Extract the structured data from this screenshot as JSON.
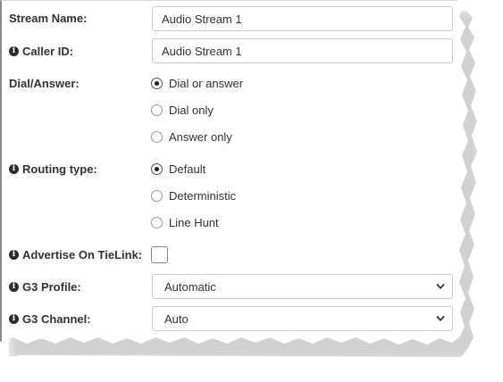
{
  "form": {
    "stream_name": {
      "label": "Stream Name:",
      "value": "Audio Stream 1"
    },
    "caller_id": {
      "label": "Caller ID:",
      "value": "Audio Stream 1",
      "icon": "info-icon"
    },
    "dial_answer": {
      "label": "Dial/Answer:",
      "options": [
        "Dial or answer",
        "Dial only",
        "Answer only"
      ],
      "selected": "Dial or answer"
    },
    "routing_type": {
      "label": "Routing type:",
      "icon": "info-icon",
      "options": [
        "Default",
        "Deterministic",
        "Line Hunt"
      ],
      "selected": "Default"
    },
    "advertise_tielink": {
      "label": "Advertise On TieLink:",
      "icon": "info-icon",
      "checked": false
    },
    "g3_profile": {
      "label": "G3 Profile:",
      "icon": "info-icon",
      "value": "Automatic"
    },
    "g3_channel": {
      "label": "G3 Channel:",
      "icon": "info-icon",
      "value": "Auto"
    }
  },
  "colors": {
    "text": "#333333",
    "border": "#cccccc",
    "radio_fill": "#222222"
  }
}
